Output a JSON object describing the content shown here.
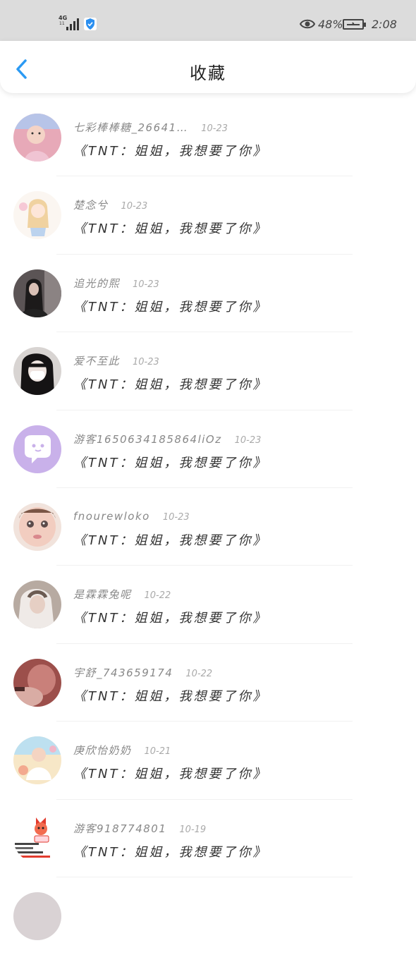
{
  "status_bar": {
    "network": "4G",
    "network_sub": "11",
    "battery_percent": "48%",
    "time": "2:08"
  },
  "nav": {
    "title": "收藏"
  },
  "favorites": [
    {
      "name": "七彩棒棒糖_26641…",
      "date": "10-23",
      "message": "《TNT：姐姐，我想要了你》",
      "avatar_color": "#e7a9b8"
    },
    {
      "name": "楚念兮",
      "date": "10-23",
      "message": "《TNT：姐姐，我想要了你》",
      "avatar_color": "#f3e7d8"
    },
    {
      "name": "追光的熙",
      "date": "10-23",
      "message": "《TNT：姐姐，我想要了你》",
      "avatar_color": "#4a4546"
    },
    {
      "name": "爱不至此",
      "date": "10-23",
      "message": "《TNT：姐姐，我想要了你》",
      "avatar_color": "#2c2a2b"
    },
    {
      "name": "游客1650634185864liOz",
      "date": "10-23",
      "message": "《TNT：姐姐，我想要了你》",
      "avatar_color": "#c9b1ea"
    },
    {
      "name": "fnourewloko",
      "date": "10-23",
      "message": "《TNT：姐姐，我想要了你》",
      "avatar_color": "#e9cdc3"
    },
    {
      "name": "是霖霖兔呢",
      "date": "10-22",
      "message": "《TNT：姐姐，我想要了你》",
      "avatar_color": "#bfb0a6"
    },
    {
      "name": "宇舒_743659174",
      "date": "10-22",
      "message": "《TNT：姐姐，我想要了你》",
      "avatar_color": "#a05a55"
    },
    {
      "name": "庚欣怡奶奶",
      "date": "10-21",
      "message": "《TNT：姐姐，我想要了你》",
      "avatar_color": "#f2d9a8"
    },
    {
      "name": "游客918774801",
      "date": "10-19",
      "message": "《TNT：姐姐，我想要了你》",
      "avatar_color": "#ffffff"
    }
  ]
}
